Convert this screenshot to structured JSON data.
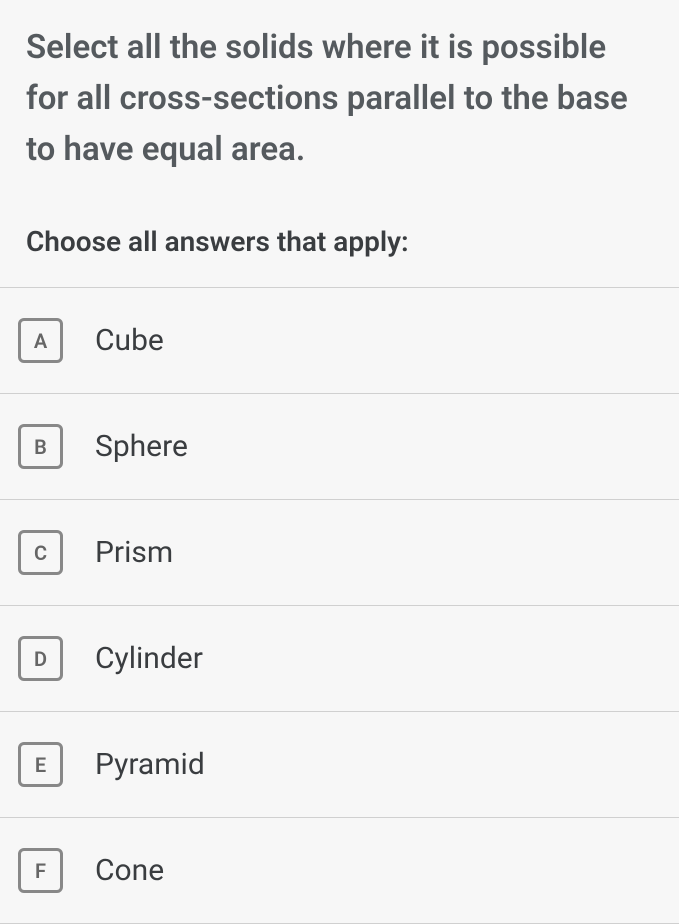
{
  "question": "Select all the solids where it is possible for all cross-sections parallel to the base to have equal area.",
  "instruction": "Choose all answers that apply:",
  "options": [
    {
      "letter": "A",
      "label": "Cube"
    },
    {
      "letter": "B",
      "label": "Sphere"
    },
    {
      "letter": "C",
      "label": "Prism"
    },
    {
      "letter": "D",
      "label": "Cylinder"
    },
    {
      "letter": "E",
      "label": "Pyramid"
    },
    {
      "letter": "F",
      "label": "Cone"
    }
  ]
}
